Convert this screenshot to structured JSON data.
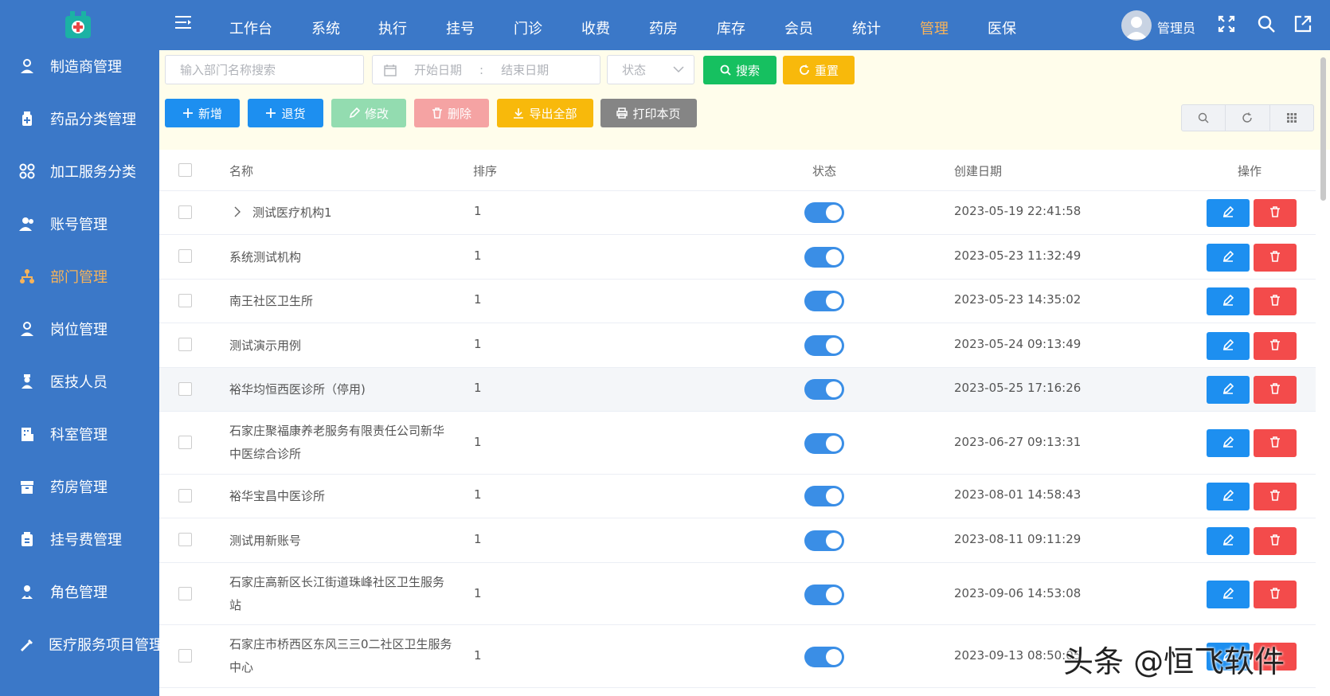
{
  "sidebar": {
    "items": [
      {
        "label": "制造商管理",
        "icon": "user-badge-icon"
      },
      {
        "label": "药品分类管理",
        "icon": "medicine-box-icon"
      },
      {
        "label": "加工服务分类",
        "icon": "grid-circles-icon"
      },
      {
        "label": "账号管理",
        "icon": "users-icon"
      },
      {
        "label": "部门管理",
        "icon": "org-chart-icon"
      },
      {
        "label": "岗位管理",
        "icon": "user-badge-icon"
      },
      {
        "label": "医技人员",
        "icon": "doctor-icon"
      },
      {
        "label": "科室管理",
        "icon": "building-icon"
      },
      {
        "label": "药房管理",
        "icon": "pharmacy-icon"
      },
      {
        "label": "挂号费管理",
        "icon": "register-icon"
      },
      {
        "label": "角色管理",
        "icon": "role-icon"
      },
      {
        "label": "医疗服务项目管理",
        "icon": "syringe-icon"
      }
    ],
    "active_index": 4
  },
  "nav": {
    "items": [
      "工作台",
      "系统",
      "执行",
      "挂号",
      "门诊",
      "收费",
      "药房",
      "库存",
      "会员",
      "统计",
      "管理",
      "医保"
    ],
    "active_index": 10
  },
  "user": {
    "name": "管理员"
  },
  "search": {
    "dept_placeholder": "输入部门名称搜索",
    "start_placeholder": "开始日期",
    "date_sep": ":",
    "end_placeholder": "结束日期",
    "status_placeholder": "状态"
  },
  "buttons": {
    "search": "搜索",
    "reset": "重置",
    "add": "新增",
    "return": "退货",
    "edit": "修改",
    "delete": "删除",
    "export": "导出全部",
    "print": "打印本页"
  },
  "table": {
    "headers": {
      "name": "名称",
      "sort": "排序",
      "status": "状态",
      "created": "创建日期",
      "actions": "操作"
    },
    "rows": [
      {
        "name": "测试医疗机构1",
        "sort": "1",
        "enabled": true,
        "created": "2023-05-19 22:41:58",
        "expandable": true
      },
      {
        "name": "系统测试机构",
        "sort": "1",
        "enabled": true,
        "created": "2023-05-23 11:32:49"
      },
      {
        "name": "南王社区卫生所",
        "sort": "1",
        "enabled": true,
        "created": "2023-05-23 14:35:02"
      },
      {
        "name": "测试演示用例",
        "sort": "1",
        "enabled": true,
        "created": "2023-05-24 09:13:49"
      },
      {
        "name": "裕华均恒西医诊所（停用)",
        "sort": "1",
        "enabled": true,
        "created": "2023-05-25 17:16:26",
        "highlight": true
      },
      {
        "name": "石家庄聚福康养老服务有限责任公司新华中医综合诊所",
        "sort": "1",
        "enabled": true,
        "created": "2023-06-27 09:13:31"
      },
      {
        "name": "裕华宝昌中医诊所",
        "sort": "1",
        "enabled": true,
        "created": "2023-08-01 14:58:43"
      },
      {
        "name": "测试用新账号",
        "sort": "1",
        "enabled": true,
        "created": "2023-08-11 09:11:29"
      },
      {
        "name": "石家庄高新区长江街道珠峰社区卫生服务站",
        "sort": "1",
        "enabled": true,
        "created": "2023-09-06 14:53:08"
      },
      {
        "name": "石家庄市桥西区东风三三0二社区卫生服务中心",
        "sort": "1",
        "enabled": true,
        "created": "2023-09-13 08:50:05"
      }
    ]
  },
  "watermark": "头条 @恒飞软件",
  "colors": {
    "primary": "#3b78c8",
    "active": "#f7b35a",
    "search_btn": "#16c060",
    "reset_btn": "#f8b90b",
    "add_btn": "#1d8ff0",
    "edit_disabled": "#93dcb0",
    "delete_disabled": "#f5a3a3",
    "print_btn": "#858585",
    "delete": "#f34b4b",
    "toggle_on": "#3a8ee6"
  }
}
